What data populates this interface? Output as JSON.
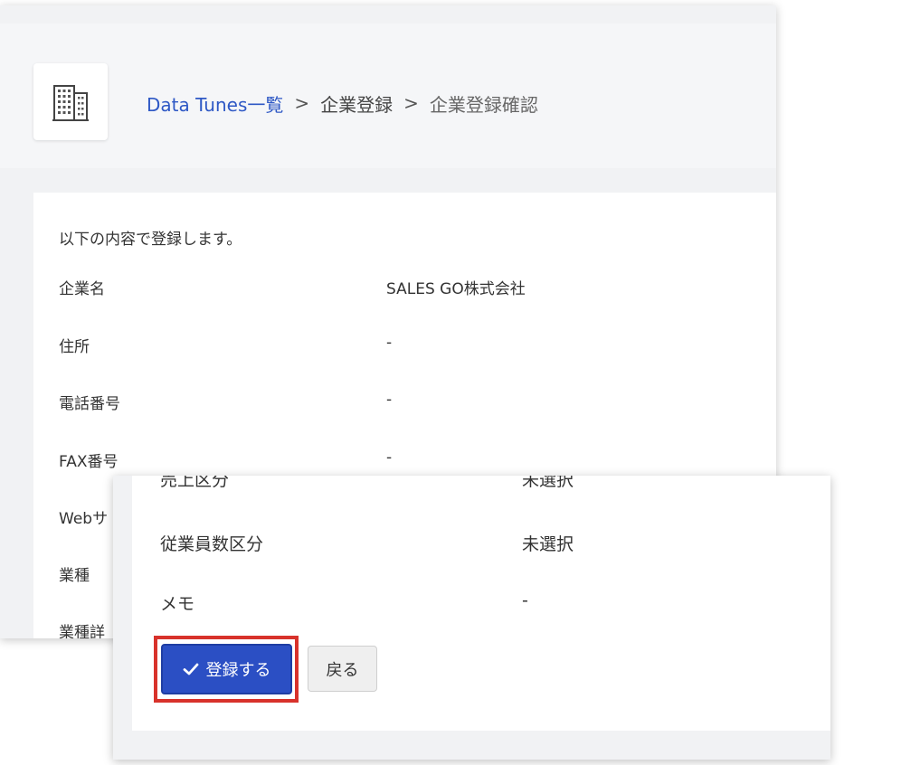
{
  "breadcrumb": {
    "list_link": "Data Tunes一覧",
    "separator": ">",
    "register": "企業登録",
    "confirm": "企業登録確認"
  },
  "form": {
    "intro": "以下の内容で登録します。",
    "rows": [
      {
        "label": "企業名",
        "value": "SALES GO株式会社"
      },
      {
        "label": "住所",
        "value": "-"
      },
      {
        "label": "電話番号",
        "value": "-"
      },
      {
        "label": "FAX番号",
        "value": "-"
      },
      {
        "label": "Webサ",
        "value": ""
      },
      {
        "label": "業種",
        "value": ""
      },
      {
        "label": "業種詳",
        "value": ""
      }
    ]
  },
  "confirm_panel": {
    "rows": [
      {
        "label": "売上区分",
        "value": "未選択"
      },
      {
        "label": "従業員数区分",
        "value": "未選択"
      },
      {
        "label": "メモ",
        "value": "-"
      }
    ]
  },
  "actions": {
    "register_label": "登録する",
    "back_label": "戻る"
  },
  "colors": {
    "primary": "#2b4fc4",
    "link": "#2e58c5",
    "highlight": "#d8322b"
  }
}
